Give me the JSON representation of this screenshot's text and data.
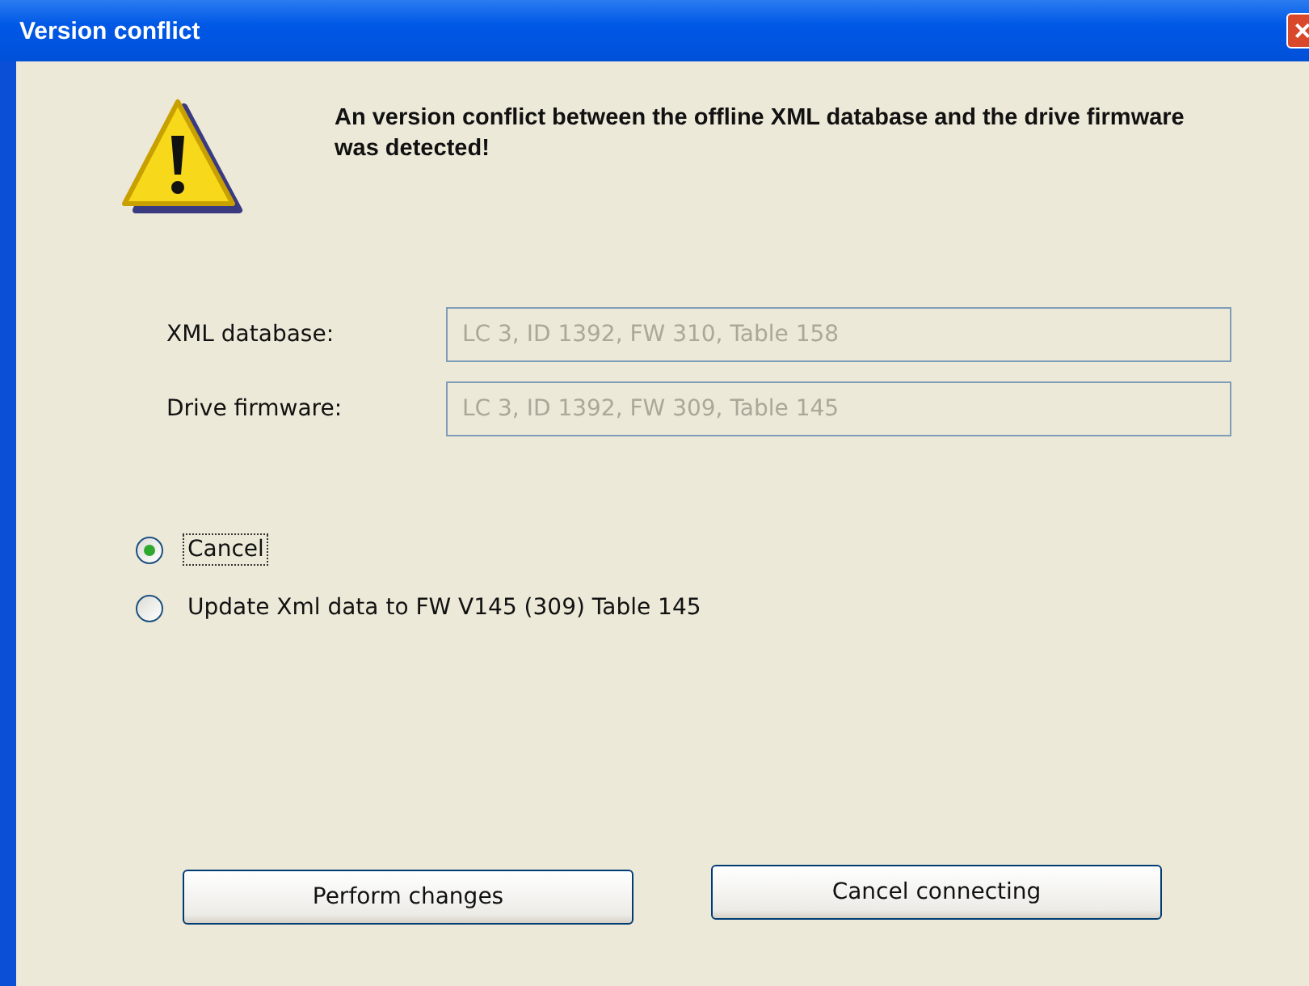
{
  "window": {
    "title": "Version conflict",
    "close_glyph": "×"
  },
  "message": "An version conflict between the offline XML database and the drive firmware was detected!",
  "fields": [
    {
      "label": "XML database:",
      "value": "LC 3, ID 1392, FW 310, Table 158",
      "disabled": true
    },
    {
      "label": "Drive firmware:",
      "value": "LC 3, ID 1392, FW 309, Table 145",
      "disabled": true
    }
  ],
  "options": [
    {
      "label": "Cancel",
      "selected": true
    },
    {
      "label": "Update Xml data to FW V145 (309) Table 145",
      "selected": false
    }
  ],
  "buttons": [
    "Perform changes",
    "Cancel connecting"
  ]
}
